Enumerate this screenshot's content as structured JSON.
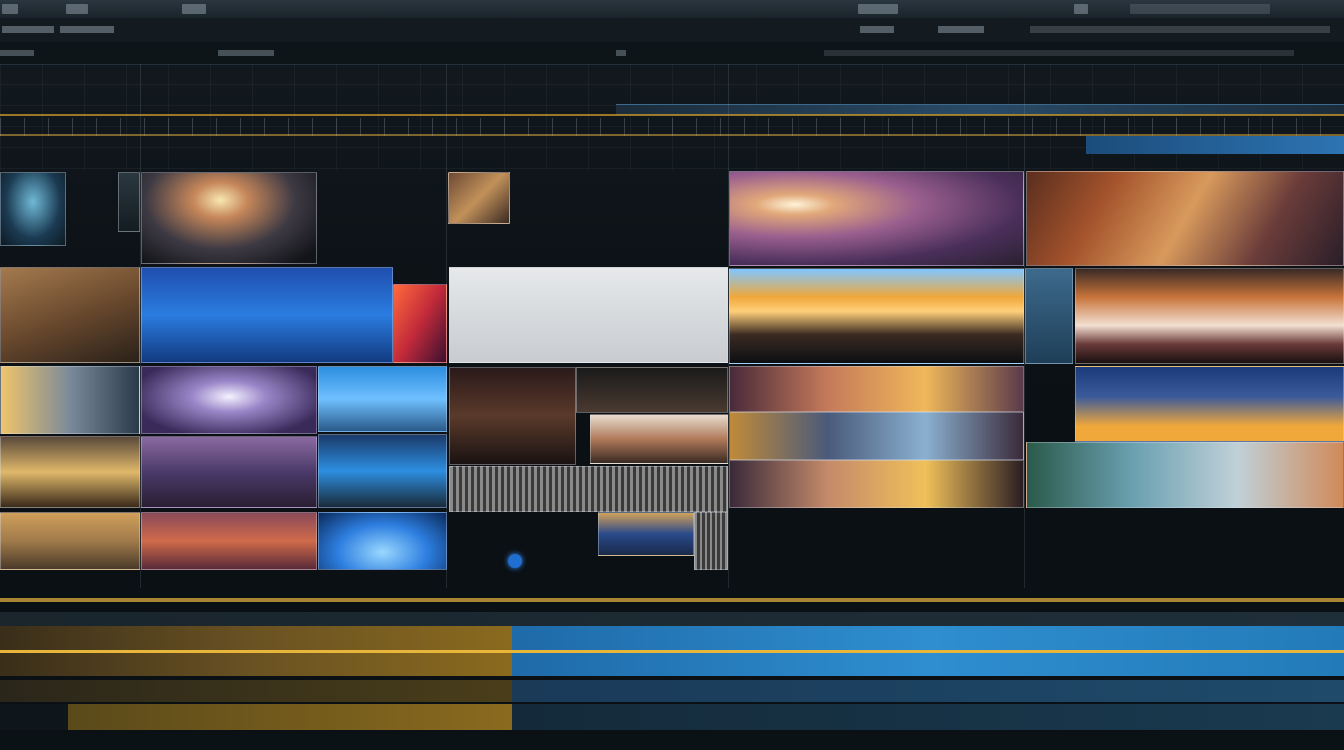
{
  "toolbar": {
    "items": [
      "menu-item",
      "menu-item",
      "menu-item",
      "menu-item",
      "menu-item",
      "menu-item"
    ]
  },
  "colors": {
    "accent_yellow": "#e8b63a",
    "accent_blue": "#2d74b3",
    "playhead": "#1f6fd1",
    "background": "#0b1014"
  },
  "timeline": {
    "tracks": [
      "video-track-1",
      "video-track-2",
      "audio-track-1",
      "audio-track-2"
    ]
  }
}
